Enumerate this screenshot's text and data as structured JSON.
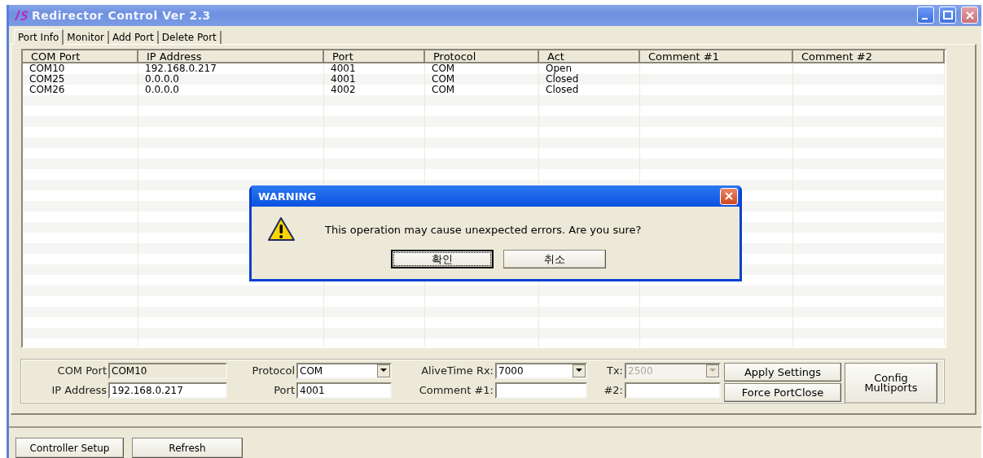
{
  "window": {
    "title": "Redirector Control Ver 2.3"
  },
  "tabs": [
    {
      "label": "Port Info",
      "selected": true
    },
    {
      "label": "Monitor",
      "selected": false
    },
    {
      "label": "Add Port",
      "selected": false
    },
    {
      "label": "Delete Port",
      "selected": false
    }
  ],
  "table": {
    "columns": [
      "COM Port",
      "IP Address",
      "Port",
      "Protocol",
      "Act",
      "Comment #1",
      "Comment #2"
    ],
    "rows": [
      [
        "COM10",
        "192.168.0.217",
        "4001",
        "COM",
        "Open"
      ],
      [
        "COM25",
        "0.0.0.0",
        "4001",
        "COM",
        "Closed"
      ],
      [
        "COM26",
        "0.0.0.0",
        "4002",
        "COM",
        "Closed"
      ]
    ]
  },
  "settings": {
    "fields": [
      {
        "kind": "text",
        "label": "COM Port",
        "value": "COM10",
        "disabled": true
      },
      {
        "kind": "dropdown",
        "label": "Protocol",
        "value": "COM",
        "disabled": false
      },
      {
        "kind": "dropdown",
        "label": "AliveTime Rx:",
        "value": "7000",
        "disabled": false
      },
      {
        "kind": "dropdown",
        "label": "Tx:",
        "value": "2500",
        "disabled": true
      },
      {
        "kind": "text",
        "label": "IP Address",
        "value": "192.168.0.217",
        "disabled": false
      },
      {
        "kind": "text",
        "label": "Port",
        "value": "4001",
        "disabled": false
      },
      {
        "kind": "text",
        "label": "Comment #1:",
        "disabled": false
      },
      {
        "kind": "text",
        "label": "#2:",
        "disabled": false
      }
    ],
    "buttons": [
      "Apply Settings",
      "Force PortClose"
    ],
    "big_button": "Config Multiports"
  },
  "footer_buttons": [
    "Controller Setup",
    "Refresh"
  ],
  "dialog": {
    "title": "WARNING",
    "message": "This operation may cause unexpected errors. Are you sure?",
    "buttons": [
      {
        "label": "확인",
        "focused": true
      },
      {
        "label": "취소",
        "focused": false
      }
    ]
  }
}
